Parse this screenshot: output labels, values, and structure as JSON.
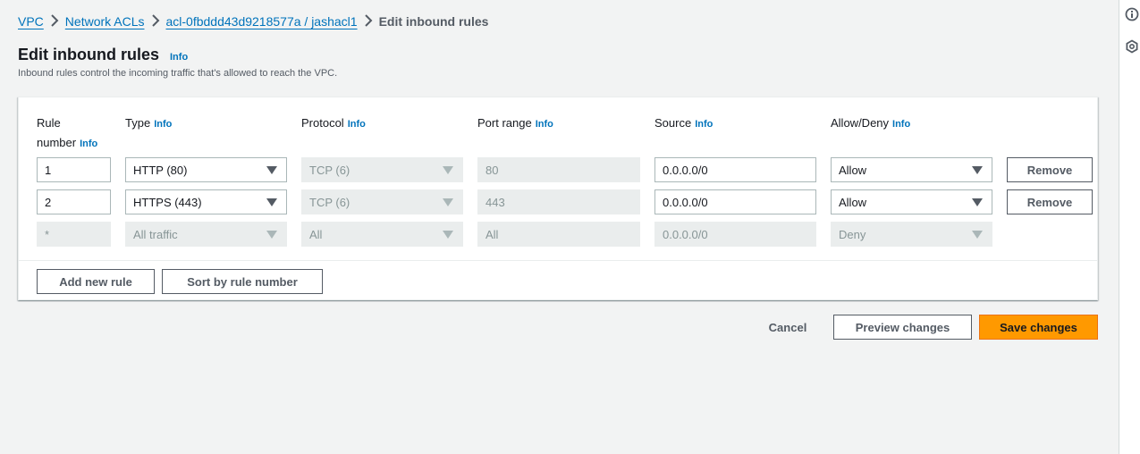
{
  "breadcrumb": {
    "items": [
      "VPC",
      "Network ACLs",
      "acl-0fbddd43d9218577a / jashacl1"
    ],
    "current": "Edit inbound rules"
  },
  "header": {
    "title": "Edit inbound rules",
    "info": "Info",
    "description": "Inbound rules control the incoming traffic that's allowed to reach the VPC."
  },
  "table": {
    "columns": {
      "rule_number": "Rule number",
      "rule_number_line1": "Rule",
      "rule_number_line2": "number",
      "type": "Type",
      "protocol": "Protocol",
      "port_range": "Port range",
      "source": "Source",
      "allow_deny": "Allow/Deny"
    },
    "info_label": "Info",
    "rows": [
      {
        "rule_number": "1",
        "type": "HTTP (80)",
        "protocol": "TCP (6)",
        "port_range": "80",
        "source": "0.0.0.0/0",
        "allow_deny": "Allow",
        "remove": "Remove"
      },
      {
        "rule_number": "2",
        "type": "HTTPS (443)",
        "protocol": "TCP (6)",
        "port_range": "443",
        "source": "0.0.0.0/0",
        "allow_deny": "Allow",
        "remove": "Remove"
      }
    ],
    "default_row": {
      "rule_number": "*",
      "type": "All traffic",
      "protocol": "All",
      "port_range": "All",
      "source": "0.0.0.0/0",
      "allow_deny": "Deny"
    }
  },
  "panel_actions": {
    "add_rule": "Add new rule",
    "sort": "Sort by rule number"
  },
  "footer": {
    "cancel": "Cancel",
    "preview": "Preview changes",
    "save": "Save changes"
  },
  "colors": {
    "link": "#0073bb",
    "primary": "#ff9900",
    "background": "#f2f3f3"
  },
  "right_rail_icons": [
    "info-icon",
    "settings-icon"
  ]
}
